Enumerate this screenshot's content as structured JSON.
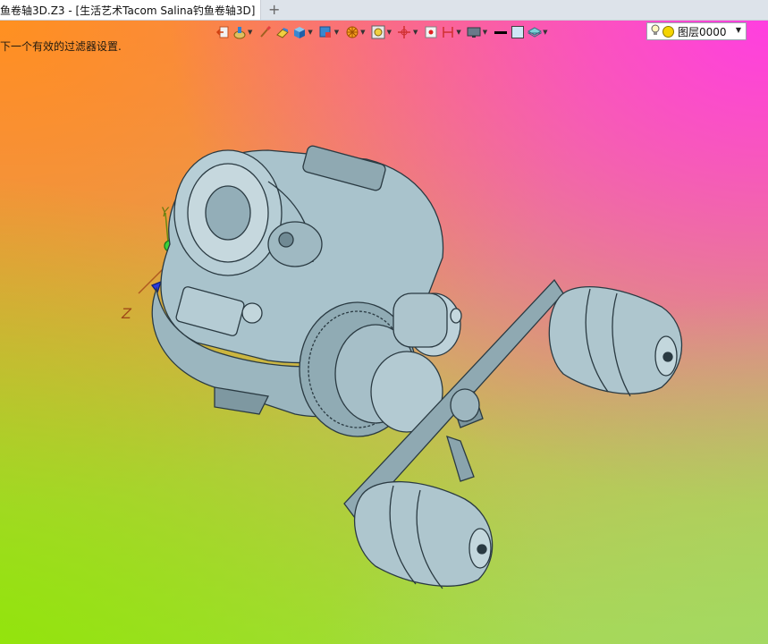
{
  "tab": {
    "title": "鱼卷轴3D.Z3 - [生活艺术Tacom Salina钓鱼卷轴3D]",
    "close_glyph": "×",
    "new_tab_glyph": "+"
  },
  "viewport": {
    "hint_text": "下一个有效的过滤器设置.",
    "axis_labels": {
      "z": "Z",
      "y": "Y"
    }
  },
  "toolbar": {
    "tools": [
      {
        "name": "exit-icon"
      },
      {
        "name": "paint-icon",
        "dropdown": true
      },
      {
        "name": "brush-icon"
      },
      {
        "name": "eraser-icon"
      },
      {
        "name": "cube-icon",
        "dropdown": true
      },
      {
        "name": "view-cube-icon",
        "dropdown": true
      },
      {
        "name": "render-mode-icon",
        "dropdown": true
      },
      {
        "name": "zoom-fit-icon",
        "dropdown": true
      },
      {
        "name": "origin-icon",
        "dropdown": true
      },
      {
        "name": "point-icon"
      },
      {
        "name": "section-icon",
        "dropdown": true
      },
      {
        "name": "display-icon",
        "dropdown": true
      },
      {
        "name": "line-color-icon"
      },
      {
        "name": "face-color-icon"
      },
      {
        "name": "layers-icon",
        "dropdown": true
      }
    ],
    "layer": {
      "value": "图层0000",
      "caret": "▼"
    }
  },
  "colors": {
    "model_fill": "#a9c3cc",
    "model_stroke": "#2a3a42"
  }
}
